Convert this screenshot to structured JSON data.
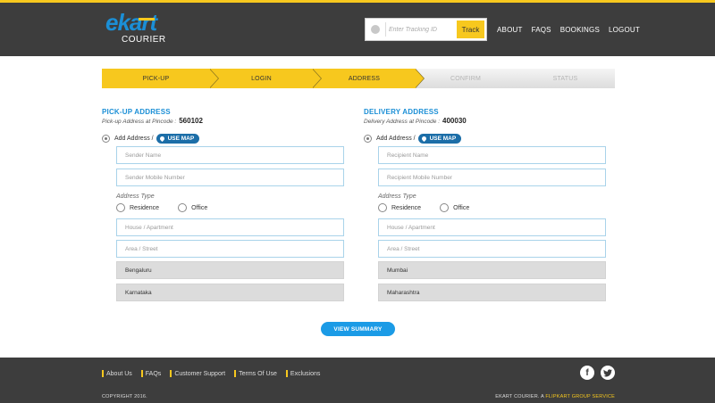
{
  "header": {
    "logo_main": "ekart",
    "logo_sub": "COURIER",
    "track_placeholder": "Enter Tracking ID",
    "track_button": "Track",
    "nav": [
      "ABOUT",
      "FAQS",
      "BOOKINGS",
      "LOGOUT"
    ]
  },
  "steps": [
    {
      "label": "PICK-UP",
      "state": "active"
    },
    {
      "label": "LOGIN",
      "state": "active"
    },
    {
      "label": "ADDRESS",
      "state": "active"
    },
    {
      "label": "CONFIRM",
      "state": "inactive"
    },
    {
      "label": "STATUS",
      "state": "inactive"
    }
  ],
  "pickup": {
    "title": "PICK-UP ADDRESS",
    "subtitle": "Pick-up Address at Pincode :",
    "pincode": "560102",
    "add_label": "Add Address /",
    "map_button": "USE MAP",
    "name_placeholder": "Sender Name",
    "mobile_placeholder": "Sender Mobile Number",
    "type_label": "Address Type",
    "type_options": [
      "Residence",
      "Office"
    ],
    "house_placeholder": "House / Apartment",
    "area_placeholder": "Area / Street",
    "city": "Bengaluru",
    "state": "Karnataka"
  },
  "delivery": {
    "title": "DELIVERY ADDRESS",
    "subtitle": "Delivery Address at Pincode :",
    "pincode": "400030",
    "add_label": "Add Address /",
    "map_button": "USE MAP",
    "name_placeholder": "Recipient Name",
    "mobile_placeholder": "Recipient Mobile Number",
    "type_label": "Address Type",
    "type_options": [
      "Residence",
      "Office"
    ],
    "house_placeholder": "House / Apartment",
    "area_placeholder": "Area / Street",
    "city": "Mumbai",
    "state": "Maharashtra"
  },
  "summary_button": "VIEW SUMMARY",
  "footer": {
    "links": [
      "About Us",
      "FAQs",
      "Customer Support",
      "Terms Of Use",
      "Exclusions"
    ],
    "copyright": "COPYRIGHT 2016.",
    "tagline_prefix": "EKART COURIER. A ",
    "tagline_brand": "FLIPKART GROUP SERVICE",
    "social": [
      "facebook-icon",
      "twitter-icon"
    ]
  },
  "colors": {
    "accent": "#f7c81e",
    "brand_blue": "#1b8fd6",
    "header_bg": "#3d3d3d"
  }
}
